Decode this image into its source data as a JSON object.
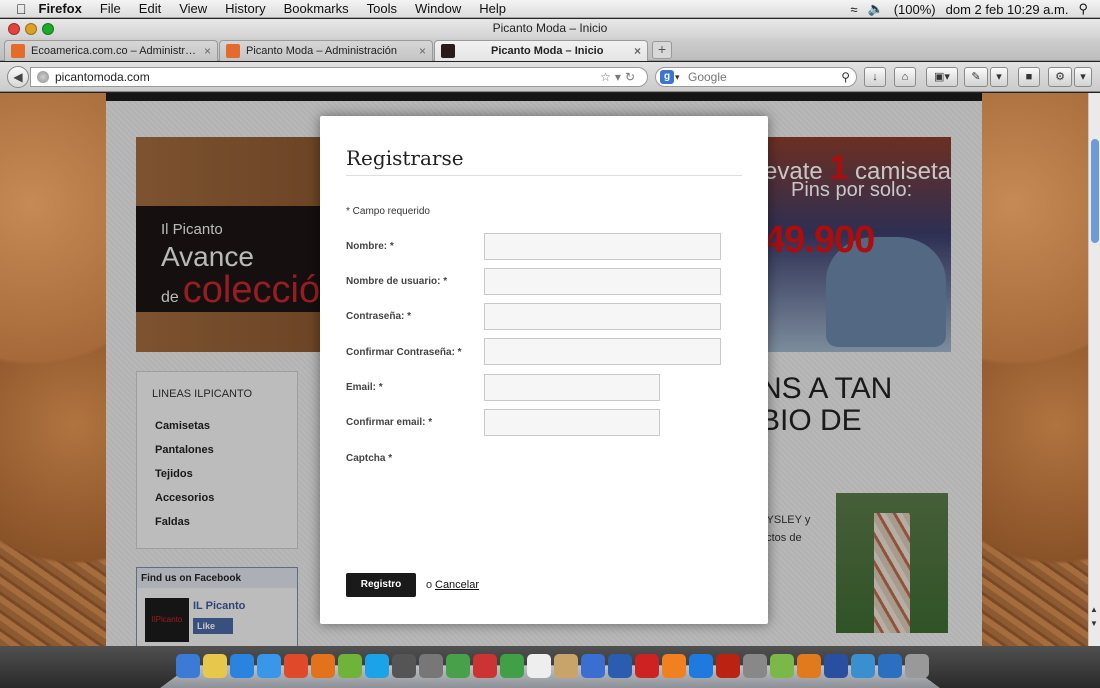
{
  "menubar": {
    "apple": "",
    "app": "Firefox",
    "items": [
      "File",
      "Edit",
      "View",
      "History",
      "Bookmarks",
      "Tools",
      "Window",
      "Help"
    ],
    "battery": "(100%)",
    "clock": "dom 2 feb  10:29 a.m."
  },
  "window": {
    "title": "Picanto Moda – Inicio"
  },
  "tabs": [
    {
      "label": "Ecoamerica.com.co – Administr…"
    },
    {
      "label": "Picanto Moda – Administración"
    },
    {
      "label": "Picanto Moda – Inicio"
    }
  ],
  "nav": {
    "url": "picantomoda.com",
    "search_placeholder": "Google"
  },
  "page": {
    "banner": {
      "line1": "Il Picanto",
      "line2": "Avance",
      "line3_prefix": "de",
      "line3_word": "colecció",
      "promo1": "evate",
      "promo1_num": "1",
      "promo1_suffix": "camiseta",
      "promo2": "Pins por solo:",
      "promo_price": "49.900"
    },
    "menu": {
      "heading": "LINEAS ILPICANTO",
      "items": [
        "Camisetas",
        "Pantalones",
        "Tejidos",
        "Accesorios",
        "Faldas"
      ]
    },
    "facebook": {
      "heading": "Find us on Facebook",
      "name": "IL Picanto",
      "like": "Like"
    },
    "heading_right": "NS A TAN\nBIO DE",
    "side_text": "AYSLEY y\nuctos de"
  },
  "modal": {
    "title": "Registrarse",
    "required_note": "* Campo requerido",
    "fields": [
      {
        "label": "Nombre: *"
      },
      {
        "label": "Nombre de usuario: *"
      },
      {
        "label": "Contraseña: *"
      },
      {
        "label": "Confirmar Contraseña: *"
      },
      {
        "label": "Email: *"
      },
      {
        "label": "Confirmar email: *"
      }
    ],
    "captcha_label": "Captcha *",
    "submit": "Registro",
    "or": "o",
    "cancel": "Cancelar"
  },
  "dock": [
    "Finder",
    "Stickies",
    "App Store",
    "Safari",
    "Chrome",
    "Firefox",
    "Spotify",
    "Skype",
    "Activity",
    "Utility",
    "Maps",
    "Gift",
    "Leaf",
    "Calendar",
    "Preview",
    "iTunes",
    "Adium",
    "FileZilla",
    "VLC",
    "Dropbox",
    "Acrobat",
    "ClipView",
    "Box",
    "Lightroom",
    "Photoshop",
    "Ultra",
    "Weebly",
    "Trash"
  ]
}
